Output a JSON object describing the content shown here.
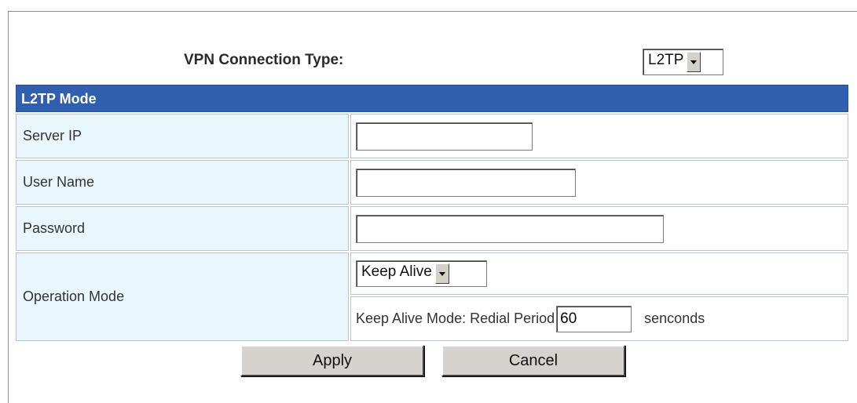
{
  "vpn": {
    "connection_type_label": "VPN Connection Type:",
    "connection_type_value": "L2TP"
  },
  "section": {
    "title": "L2TP Mode"
  },
  "fields": {
    "server_ip": {
      "label": "Server IP",
      "value": ""
    },
    "user_name": {
      "label": "User Name",
      "value": ""
    },
    "password": {
      "label": "Password",
      "value": ""
    }
  },
  "operation": {
    "label": "Operation Mode",
    "mode_value": "Keep Alive",
    "redial_label": "Keep Alive Mode: Redial Period",
    "redial_value": "60",
    "redial_unit": "senconds"
  },
  "buttons": {
    "apply": "Apply",
    "cancel": "Cancel"
  },
  "colors": {
    "header_bg": "#2f5fae",
    "label_bg": "#e9f7fd"
  }
}
